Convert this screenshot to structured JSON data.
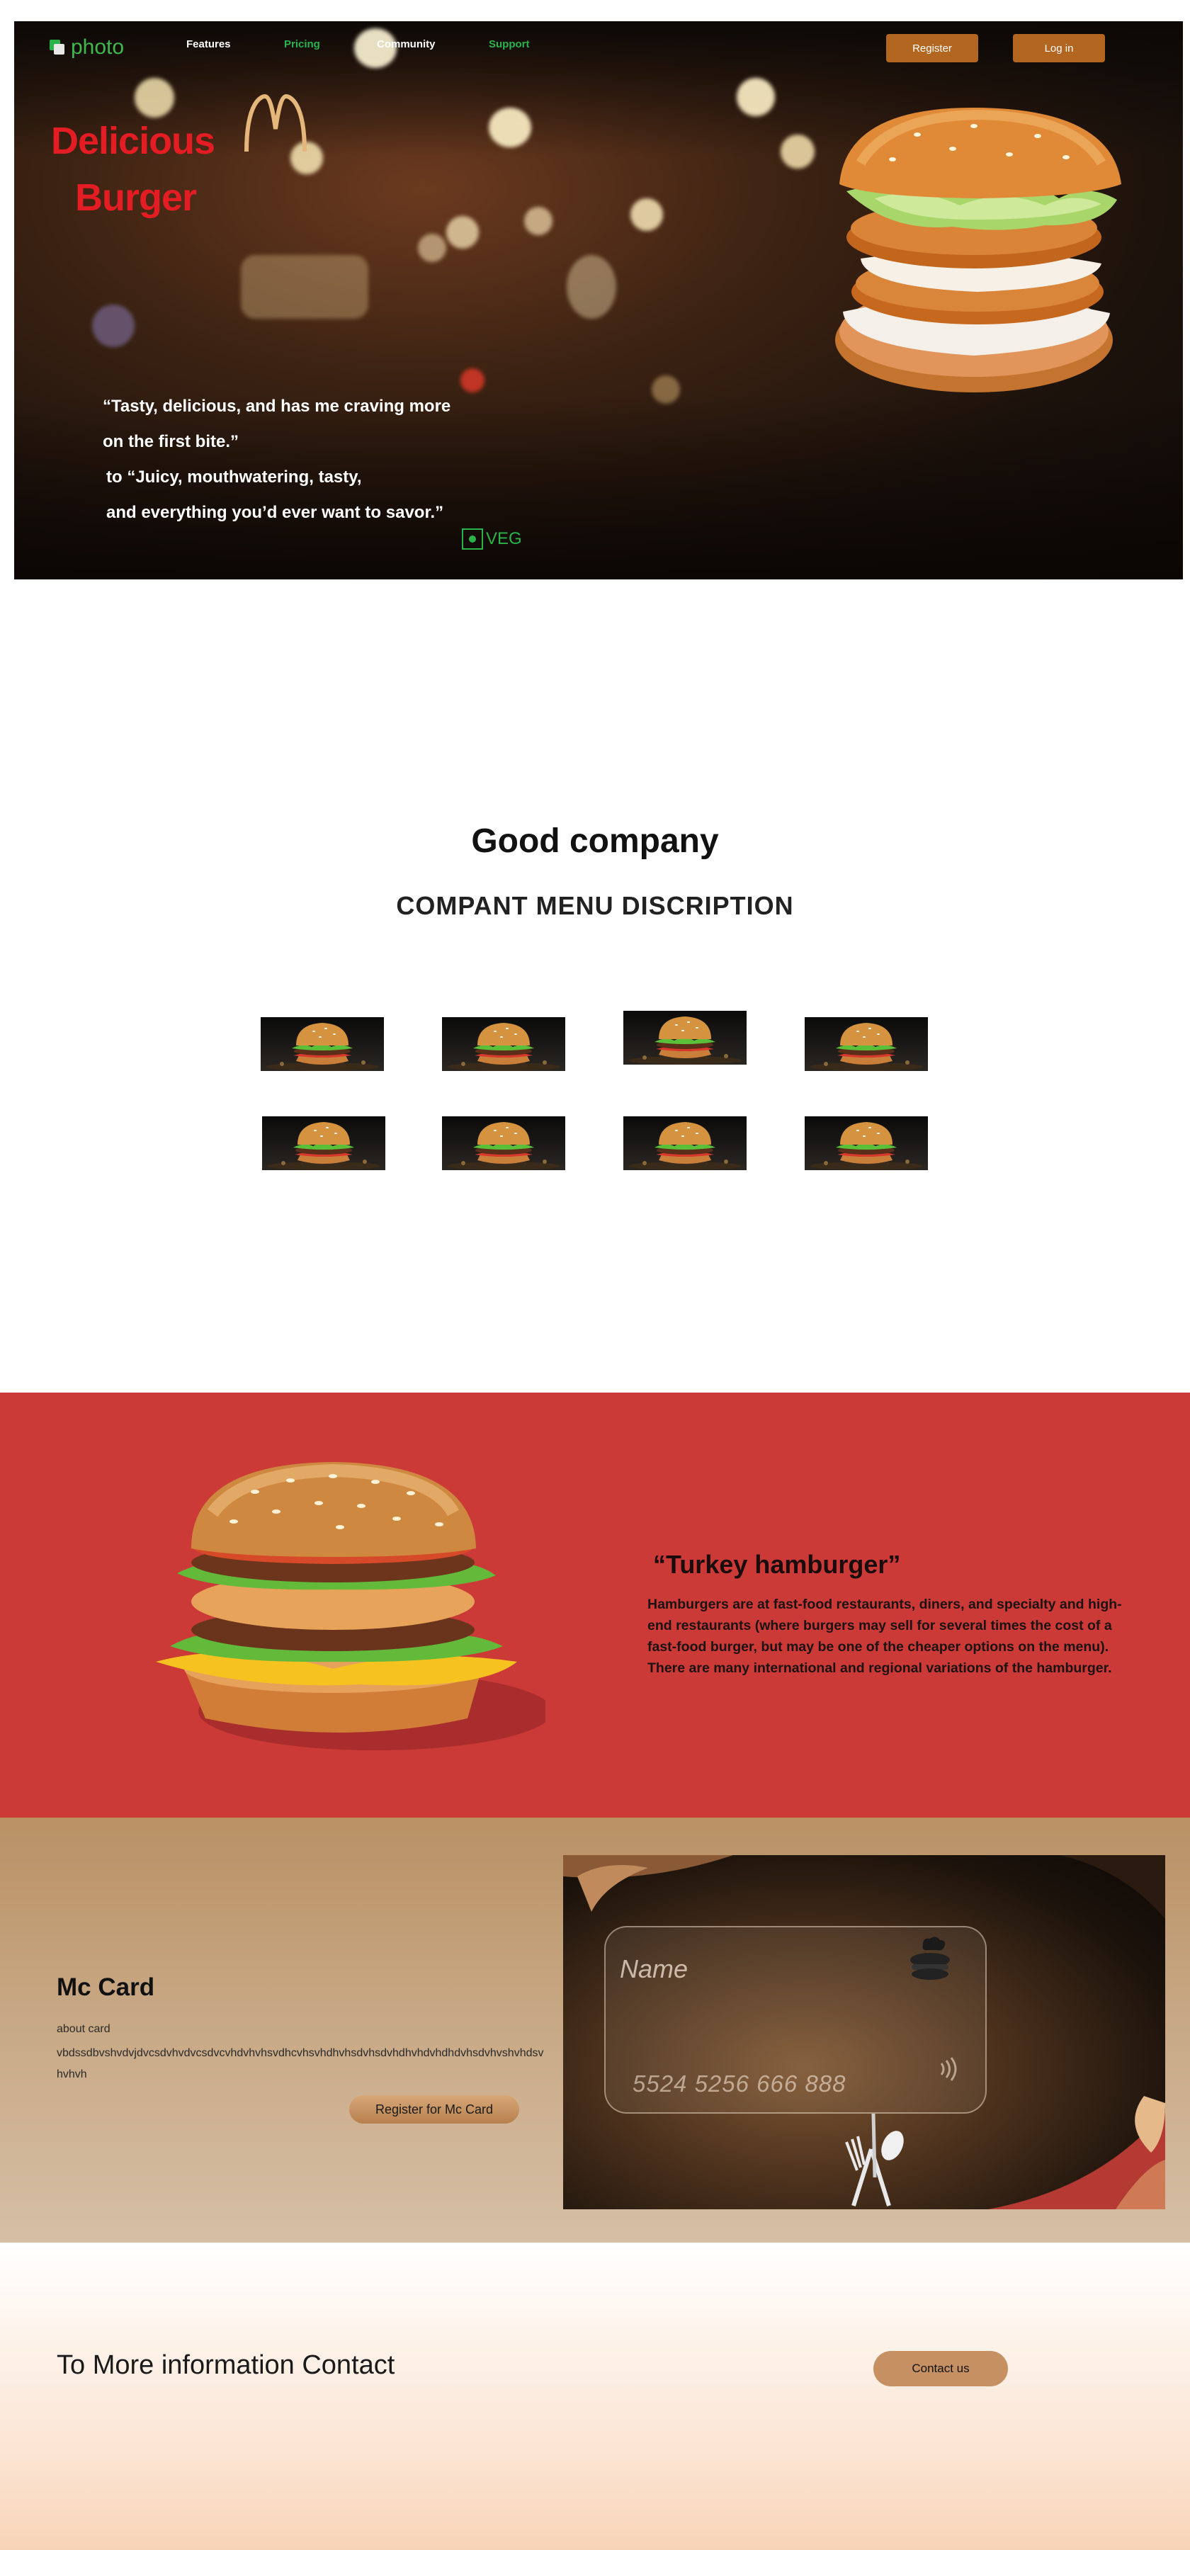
{
  "nav": {
    "logo_text": "photo",
    "links": [
      {
        "label": "Features",
        "color": "#ffffff"
      },
      {
        "label": "Pricing",
        "color": "#2bb34a"
      },
      {
        "label": "Community",
        "color": "#ffffff"
      },
      {
        "label": "Support",
        "color": "#2bb34a"
      }
    ],
    "register_label": "Register",
    "login_label": "Log in"
  },
  "hero": {
    "title_line1": "Delicious",
    "title_line2": "Burger",
    "quote_lines": [
      "“Tasty, delicious, and has me craving more",
      "on the first bite.”",
      "to “Juicy, mouthwatering, tasty,",
      "and everything you’d ever want to savor.”"
    ],
    "veg_label": "VEG",
    "colors": {
      "title": "#e41c23",
      "veg": "#2bb34a",
      "arch": "#e5b77a"
    }
  },
  "menu": {
    "heading": "Good company",
    "subheading": "COMPANT MENU DISCRIPTION",
    "thumbnail_count": 8
  },
  "feature": {
    "title": "“Turkey hamburger”",
    "text": "Hamburgers are   at fast-food restaurants, diners, and specialty and high-end restaurants (where burgers may sell for several times the cost of a fast-food burger, but may be one of the cheaper options on the menu). There are many international and regional variations of the hamburger.",
    "background": "#cc3a38"
  },
  "mc_card": {
    "title": "Mc Card",
    "about": "about card",
    "text": "vbdssdbvshvdvjdvcsdvhvdvcsdvcvhdvhvhsvdhcvhsvhdhvhsdvhsdvhdhvhdvhdhdvhsdvhvshvhdsvhvhvh",
    "button_label": "Register for Mc Card",
    "card_name_placeholder": "Name",
    "card_number": "5524 5256 666 888"
  },
  "contact": {
    "text": "To More information Contact",
    "button_label": "Contact us"
  }
}
